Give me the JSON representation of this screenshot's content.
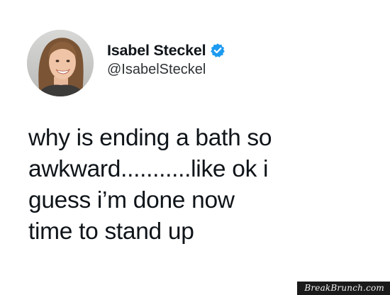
{
  "author": {
    "display_name": "Isabel Steckel",
    "handle": "@IsabelSteckel",
    "verified_icon": "verified-badge-icon",
    "verified_color": "#1d9bf0"
  },
  "tweet": {
    "lines": [
      "why is ending a bath so",
      "awkward...........like ok i",
      "guess i’m done now",
      "time to stand up"
    ]
  },
  "watermark": {
    "text": "BreakBrunch.com"
  }
}
